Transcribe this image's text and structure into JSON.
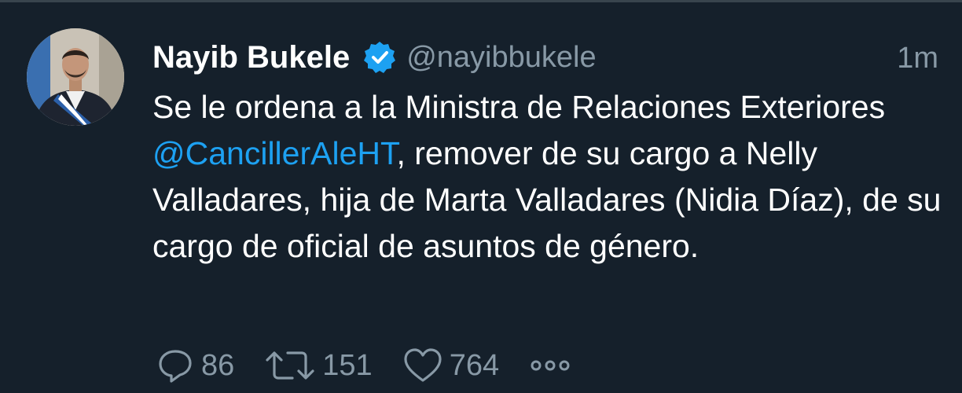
{
  "tweet": {
    "author": {
      "name": "Nayib Bukele",
      "handle": "@nayibbukele",
      "verified": true,
      "avatar_icon": "profile-avatar"
    },
    "timestamp": "1m",
    "text": {
      "part1": "Se le ordena a la Ministra de Relaciones Exteriores ",
      "mention": "@CancillerAleHT",
      "part2": ", remover de su cargo a Nelly Valladares, hija de Marta Valladares (Nidia Díaz), de su cargo de oficial de asuntos de género."
    },
    "actions": {
      "reply_count": "86",
      "retweet_count": "151",
      "like_count": "764"
    }
  },
  "colors": {
    "background": "#15202b",
    "accent": "#1da1f2",
    "muted": "#8899a6",
    "text": "#ffffff"
  }
}
